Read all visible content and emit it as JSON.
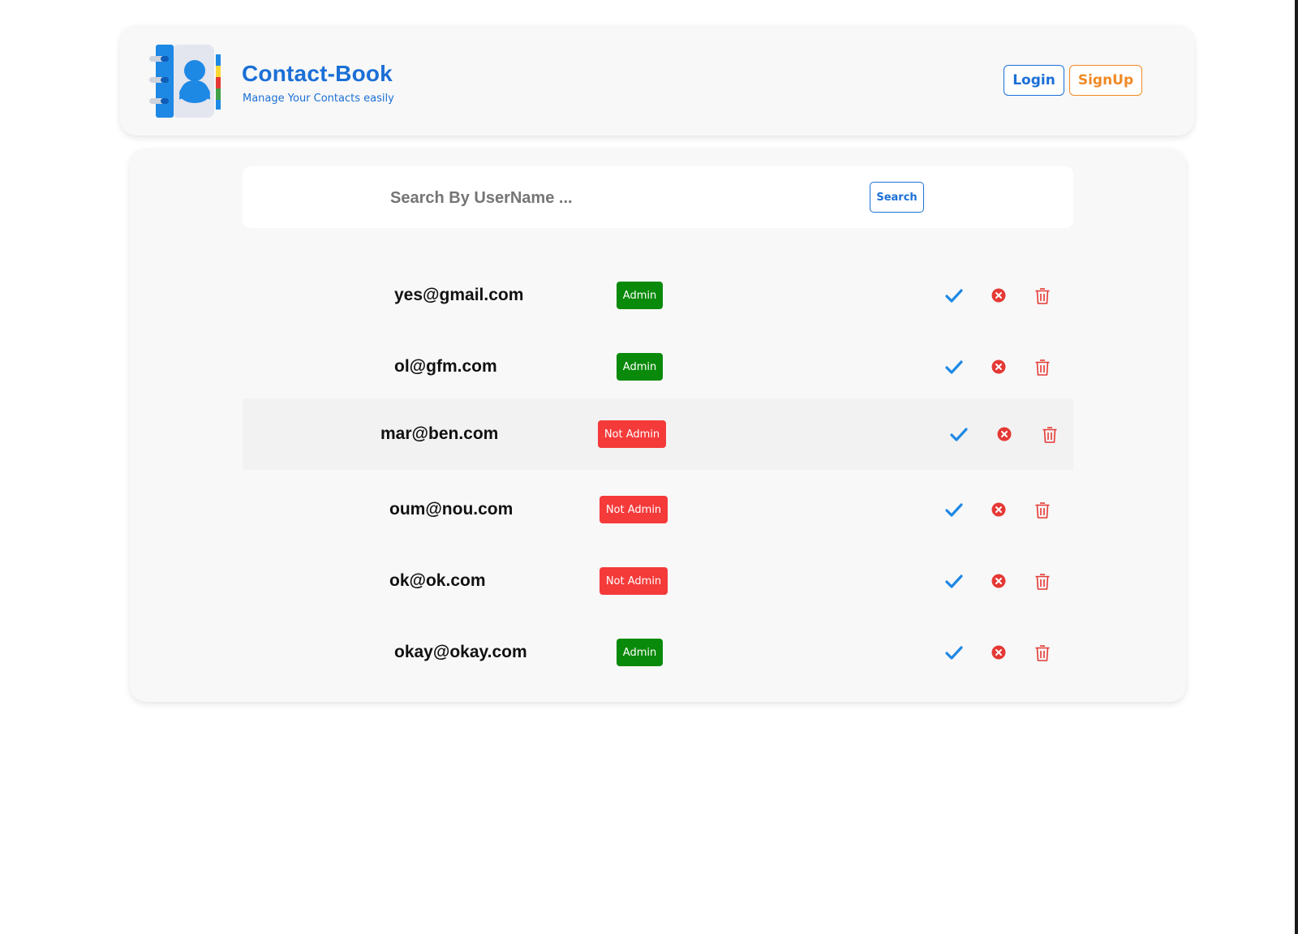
{
  "header": {
    "title": "Contact-Book",
    "subtitle": "Manage Your Contacts easily",
    "logo_icon": "contact-book-icon",
    "login_label": "Login",
    "signup_label": "SignUp"
  },
  "search": {
    "placeholder": "Search By UserName ...",
    "value": "",
    "button_label": "Search"
  },
  "users": [
    {
      "email": "yes@gmail.com",
      "role": "Admin"
    },
    {
      "email": "ol@gfm.com",
      "role": "Admin"
    },
    {
      "email": "mar@ben.com",
      "role": "Not Admin"
    },
    {
      "email": "oum@nou.com",
      "role": "Not Admin"
    },
    {
      "email": "ok@ok.com",
      "role": "Not Admin"
    },
    {
      "email": "okay@okay.com",
      "role": "Admin"
    }
  ],
  "row_actions": [
    "check-icon",
    "close-circle-icon",
    "trash-icon"
  ],
  "colors": {
    "brand_blue": "#1b6fd6",
    "signup_orange": "#f08a24",
    "admin_green": "#0a8a0a",
    "not_admin_red": "#f53a3a",
    "action_check": "#1e88e5",
    "action_delete": "#e53935"
  }
}
